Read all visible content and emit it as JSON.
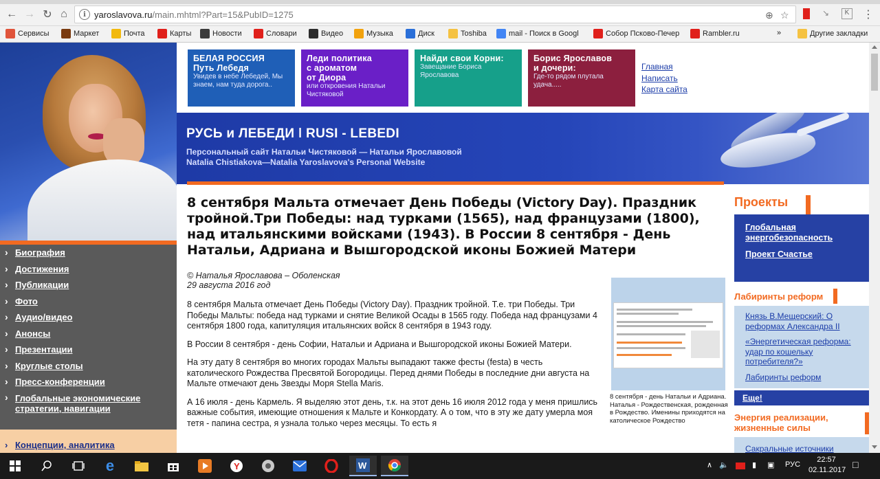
{
  "browser": {
    "url_host": "yaroslavova.ru",
    "url_path": "/main.mhtml?Part=15&PubID=1275"
  },
  "bookmarks": [
    {
      "label": "Сервисы",
      "icon": "apps-grid-icon",
      "color": "#e0543b"
    },
    {
      "label": "Маркет",
      "icon": "market-icon",
      "color": "#7a3b10"
    },
    {
      "label": "Почта",
      "icon": "mail-icon",
      "color": "#f2b90e"
    },
    {
      "label": "Карты",
      "icon": "map-pin-icon",
      "color": "#e0201b"
    },
    {
      "label": "Новости",
      "icon": "news-icon",
      "color": "#3b3b3b"
    },
    {
      "label": "Словари",
      "icon": "dictionary-icon",
      "color": "#e0201b"
    },
    {
      "label": "Видео",
      "icon": "video-icon",
      "color": "#2d2d2d"
    },
    {
      "label": "Музыка",
      "icon": "music-icon",
      "color": "#f2a20e"
    },
    {
      "label": "Диск",
      "icon": "disk-icon",
      "color": "#2a6fd8"
    },
    {
      "label": "Toshiba",
      "icon": "folder-icon",
      "color": "#f5c242"
    },
    {
      "label": "mail - Поиск в Googl",
      "icon": "google-icon",
      "color": "#4285f4"
    },
    {
      "label": "Собор Псково-Печер",
      "icon": "yandex-icon",
      "color": "#e0201b"
    },
    {
      "label": "Rambler.ru",
      "icon": "rambler-icon",
      "color": "#e0201b"
    },
    {
      "label": "»",
      "icon": "chevron-more-icon",
      "color": "#555555"
    },
    {
      "label": "Другие закладки",
      "icon": "folder-icon",
      "color": "#f5c242"
    }
  ],
  "promos": [
    {
      "title1": "БЕЛАЯ РОССИЯ",
      "title2": "Путь Лебедя",
      "sub": "Увидев в небе Лебедей, Мы знаем, нам туда дорога..",
      "bg": "#1f5fb7"
    },
    {
      "title1": "Леди политика",
      "title2": "с ароматом",
      "title3": "от Диора",
      "sub": "или откровения Натальи Чистяковой",
      "bg": "#6a1fc7"
    },
    {
      "title1": "Найди свои Корни:",
      "sub": "Завещание Бориса Ярославова",
      "bg": "#16a08a"
    },
    {
      "title1": "Борис Ярославов",
      "title2": "и дочери:",
      "sub": "Где-то рядом плутала удача.....",
      "bg": "#8c1f3e"
    }
  ],
  "toplinks": [
    "Главная",
    "Написать",
    "Карта сайта"
  ],
  "banner": {
    "title": "РУСЬ и ЛЕБЕДИ ǀ RUSI - LEBEDI",
    "sub1": "Персональный сайт Натальи Чистяковой — Натальи Ярославовой",
    "sub2": "Natalia Chistiakova—Natalia Yaroslavova's  Personal Website"
  },
  "leftnav": [
    "Биография",
    "Достижения",
    "Публикации",
    "Фото",
    "Аудио/видео",
    "Анонсы",
    "Презентации",
    "Круглые столы",
    "Пресс-конференции",
    "Глобальные экономические стратегии, навигации"
  ],
  "concept": "Концепции, аналитика",
  "article": {
    "headline": "8 сентября Мальта отмечает День Победы (Victory Day). Праздник тройной.Три Победы: над турками (1565), над французами (1800), над итальянскими войсками (1943). В России 8 сентября - День Натальи, Адриана и Вышгородской иконы Божией Матери",
    "author": "© Наталья Ярославова – Оболенская",
    "date": "29 августа 2016 год",
    "paragraphs": [
      "8 сентября Мальта отмечает День Победы (Victory Day). Праздник тройной. Т.е. три Победы. Три Победы Мальты: победа над турками и снятие Великой Осады в 1565 году. Победа над французами 4 сентября 1800 года, капитуляция итальянских войск 8 сентября в 1943 году.",
      "В России 8 сентября - день Софии, Натальи и Адриана и Вышгородской иконы Божией Матери.",
      "На эту дату 8 сентября во многих городах Мальты выпадают также фесты (festa) в честь католического Рождества Пресвятой Богородицы. Перед днями Победы в последние дни августа на Мальте отмечают день Звезды Моря Stella Maris.",
      "А 16 июля - день Кармель. Я выделяю этот день, т.к. на этот день 16 июля 2012 года у меня пришлись важные события, имеющие отношения к Мальте и Конкордату. А о том, что в эту же дату умерла моя тетя - папина сестра, я узнала только через месяцы. То есть я"
    ],
    "caption": "8 сентября - день Натальи и Адриана. Наталья - Рождественская, рожденная в Рождество. Именины приходятся на католическое Рождество"
  },
  "right": {
    "projects_title": "Проекты",
    "projects": [
      "Глобальная энергобезопасность",
      "Проект Счастье"
    ],
    "labyrinth_title": "Лабиринты реформ",
    "labyrinth_links": [
      "Князь В.Мещерский: О реформах Александра II",
      "«Энергетическая реформа: удар по кошельку потребителя?»",
      "Лабиринты реформ"
    ],
    "more": "Еще!",
    "energy_title": "Энергия реализации, жизненные силы",
    "energy_link": "Сакральные источники"
  },
  "taskbar": {
    "lang": "РУС",
    "time": "22:57",
    "date": "02.11.2017"
  },
  "colors": {
    "accent_orange": "#f26a21",
    "nav_blue": "#2641a4",
    "link_blue": "#1b3ca8",
    "left_gray": "#5a5a5a"
  }
}
